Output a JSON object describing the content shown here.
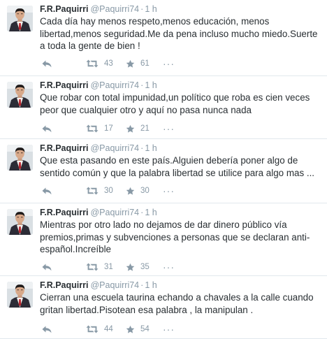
{
  "colors": {
    "text": "#292f33",
    "muted": "#8899a6",
    "divider": "#e1e8ed",
    "avatar_jacket": "#2c2c36",
    "avatar_shirt": "#f4f1ee",
    "avatar_tie": "#b8272f",
    "avatar_wall": "#d9dfe3"
  },
  "icons": {
    "reply": "reply-icon",
    "retweet": "retweet-icon",
    "favorite": "star-icon",
    "more": "more-icon"
  },
  "tweets": [
    {
      "fullname": "F.R.Paquirri",
      "username": "@Paquirri74",
      "separator": "·",
      "time": "1 h",
      "text": "Cada día hay menos respeto,menos educación, menos libertad,menos seguridad.Me da pena incluso mucho miedo.Suerte a toda la gente de bien !",
      "retweets": "43",
      "favorites": "61",
      "more": "···"
    },
    {
      "fullname": "F.R.Paquirri",
      "username": "@Paquirri74",
      "separator": "·",
      "time": "1 h",
      "text": "Que robar con total impunidad,un político que roba es cien veces peor que cualquier otro y aquí no pasa nunca nada",
      "retweets": "17",
      "favorites": "21",
      "more": "···"
    },
    {
      "fullname": "F.R.Paquirri",
      "username": "@Paquirri74",
      "separator": "·",
      "time": "1 h",
      "text": "Que esta pasando en este país.Alguien debería poner algo de sentido común y que la palabra libertad se utilice para algo mas ...",
      "retweets": "30",
      "favorites": "30",
      "more": "···"
    },
    {
      "fullname": "F.R.Paquirri",
      "username": "@Paquirri74",
      "separator": "·",
      "time": "1 h",
      "text": "Mientras por otro lado no dejamos de dar dinero público vía premios,primas y subvenciones a personas que se declaran anti-español.Increíble",
      "retweets": "31",
      "favorites": "35",
      "more": "···"
    },
    {
      "fullname": "F.R.Paquirri",
      "username": "@Paquirri74",
      "separator": "·",
      "time": "1 h",
      "text": "Cierran una escuela taurina echando a chavales a la calle cuando gritan libertad.Pisotean esa palabra , la manipulan .",
      "retweets": "44",
      "favorites": "54",
      "more": "···"
    }
  ]
}
